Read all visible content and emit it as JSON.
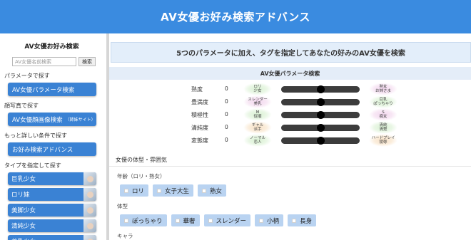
{
  "header": {
    "title": "AV女優お好み検索アドバンス"
  },
  "sidebar": {
    "title": "AV女優お好み検索",
    "search": {
      "placeholder": "AV女優名前検索",
      "button": "検索"
    },
    "groups": [
      {
        "heading": "パラメータで探す",
        "button": "AV女優パラメータ検索",
        "note": ""
      },
      {
        "heading": "顔写真で探す",
        "button": "AV女優顔画像検索",
        "note": "（姉妹サイト）"
      },
      {
        "heading": "もっと詳しい条件で探す",
        "button": "お好み検索アドバンス",
        "note": ""
      }
    ],
    "type_heading": "タイプを指定して探す",
    "types": [
      "巨乳少女",
      "ロリ妹",
      "美脚少女",
      "清純少女",
      "美乳少女"
    ]
  },
  "main": {
    "banner": "5つのパラメータに加え、タグを指定してあなたの好みのAV女優を検索",
    "params_title": "AV女優パラメータ検索",
    "params": [
      {
        "name": "熟度",
        "value": "0",
        "left": [
          "ロリ",
          "少女"
        ],
        "right": [
          "熟女",
          "お姉さま"
        ],
        "level": 0.5,
        "left_color": "#cdeccf",
        "right_color": "#f3d3ec"
      },
      {
        "name": "豊満度",
        "value": "0",
        "left": [
          "スレンダー",
          "美乳"
        ],
        "right": [
          "巨乳",
          "ぽっちゃり"
        ],
        "level": 0.5,
        "left_color": "#f3d3ec",
        "right_color": "#cdeccf"
      },
      {
        "name": "積極性",
        "value": "0",
        "left": [
          "M",
          "従順"
        ],
        "right": [
          "S",
          "痴女"
        ],
        "level": 0.5,
        "left_color": "#cdeccf",
        "right_color": "#f3d3ec"
      },
      {
        "name": "清純度",
        "value": "0",
        "left": [
          "ギャル",
          "派手"
        ],
        "right": [
          "清純",
          "清楚"
        ],
        "level": 0.5,
        "left_color": "#f6dcc0",
        "right_color": "#cdeccf"
      },
      {
        "name": "変態度",
        "value": "0",
        "left": [
          "ノーマル",
          "恋人"
        ],
        "right": [
          "ハードプレイ",
          "陵辱"
        ],
        "level": 0.5,
        "left_color": "#cdeccf",
        "right_color": "#f6dcc0"
      }
    ],
    "body_section": "女優の体型・雰囲気",
    "age_label": "年齢（ロリ・熟女）",
    "age_tags": [
      "ロリ",
      "女子大生",
      "熟女"
    ],
    "body_label": "体型",
    "body_tags": [
      "ぽっちゃり",
      "華奢",
      "スレンダー",
      "小柄",
      "長身"
    ],
    "chara_label": "キャラ"
  }
}
